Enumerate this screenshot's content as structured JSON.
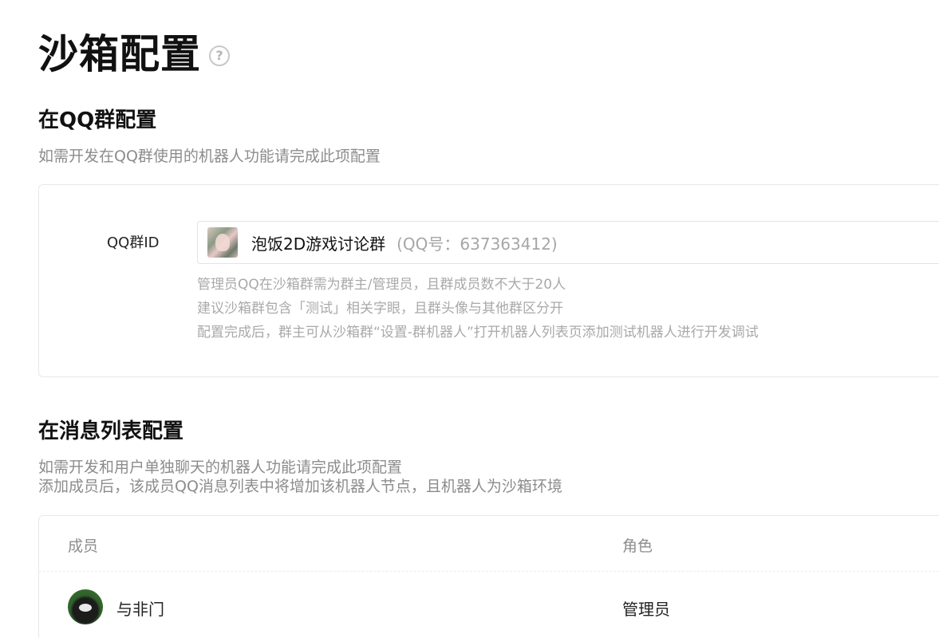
{
  "page": {
    "title": "沙箱配置",
    "help_glyph": "?"
  },
  "qq_group_section": {
    "title": "在QQ群配置",
    "description": "如需开发在QQ群使用的机器人功能请完成此项配置",
    "field_label": "QQ群ID",
    "selected_group": {
      "name": "泡饭2D游戏讨论群",
      "qq_number": "(QQ号：637363412)"
    },
    "hints": [
      "管理员QQ在沙箱群需为群主/管理员，且群成员数不大于20人",
      "建议沙箱群包含「测试」相关字眼，且群头像与其他群区分开",
      "配置完成后，群主可从沙箱群“设置-群机器人”打开机器人列表页添加测试机器人进行开发调试"
    ]
  },
  "message_list_section": {
    "title": "在消息列表配置",
    "description_lines": [
      "如需开发和用户单独聊天的机器人功能请完成此项配置",
      "添加成员后，该成员QQ消息列表中将增加该机器人节点，且机器人为沙箱环境"
    ],
    "table": {
      "columns": [
        "成员",
        "角色"
      ],
      "rows": [
        {
          "member": "与非门",
          "role": "管理员"
        }
      ]
    }
  },
  "icons": {
    "help": "question-circle-icon"
  }
}
